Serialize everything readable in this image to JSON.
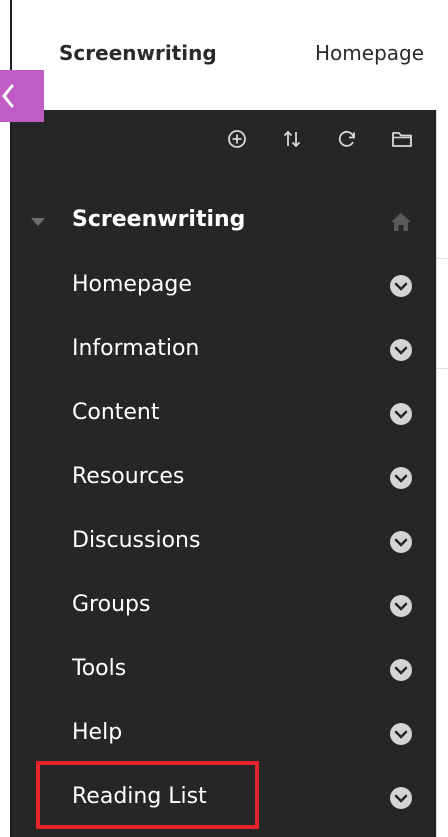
{
  "breadcrumb": {
    "course": "Screenwriting",
    "page": "Homepage"
  },
  "toolbar": {
    "icons": [
      "add-icon",
      "reorder-icon",
      "refresh-icon",
      "folder-icon"
    ]
  },
  "course_menu": {
    "title": "Screenwriting",
    "items": [
      {
        "label": "Homepage"
      },
      {
        "label": "Information"
      },
      {
        "label": "Content"
      },
      {
        "label": "Resources"
      },
      {
        "label": "Discussions"
      },
      {
        "label": "Groups"
      },
      {
        "label": "Tools"
      },
      {
        "label": "Help"
      },
      {
        "label": "Reading List"
      }
    ]
  },
  "colors": {
    "menu_background": "#262626",
    "collapse_tab": "#c05cc6",
    "highlight_border": "#e5232c",
    "chevron_icon": "#d4d4d4"
  }
}
